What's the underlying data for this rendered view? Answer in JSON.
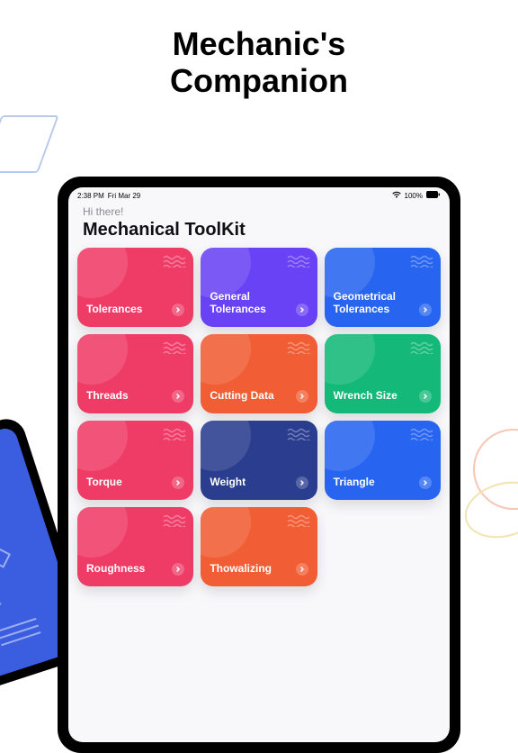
{
  "pageTitleLine1": "Mechanic's",
  "pageTitleLine2": "Companion",
  "status": {
    "time": "2:38 PM",
    "date": "Fri Mar 29",
    "battery": "100%"
  },
  "header": {
    "greeting": "Hi there!",
    "title": "Mechanical ToolKit"
  },
  "cards": [
    {
      "label": "Tolerances",
      "colorClass": "c-pink"
    },
    {
      "label": "General Tolerances",
      "colorClass": "c-purple"
    },
    {
      "label": "Geometrical Tolerances",
      "colorClass": "c-blue"
    },
    {
      "label": "Threads",
      "colorClass": "c-pink"
    },
    {
      "label": "Cutting Data",
      "colorClass": "c-orange"
    },
    {
      "label": "Wrench Size",
      "colorClass": "c-green"
    },
    {
      "label": "Torque",
      "colorClass": "c-pink"
    },
    {
      "label": "Weight",
      "colorClass": "c-navy"
    },
    {
      "label": "Triangle",
      "colorClass": "c-blue"
    },
    {
      "label": "Roughness",
      "colorClass": "c-pink"
    },
    {
      "label": "Thowalizing",
      "colorClass": "c-orange"
    }
  ]
}
